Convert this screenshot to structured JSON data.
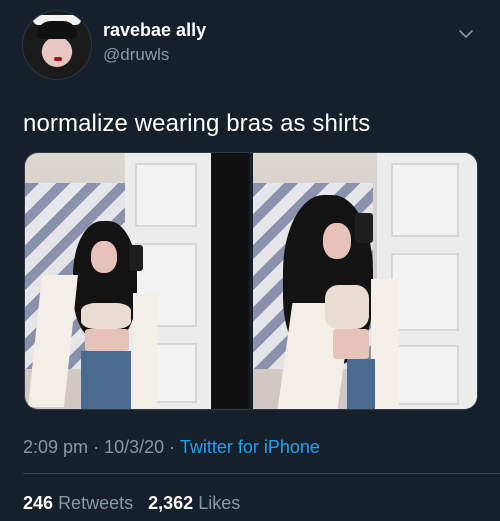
{
  "user": {
    "display_name": "ravebae ally",
    "handle": "@druwls",
    "avatar_icon": "avatar-icon"
  },
  "tweet": {
    "text": "normalize wearing bras as shirts",
    "time": "2:09 pm",
    "separator": "·",
    "date": "10/3/20",
    "source": "Twitter for iPhone"
  },
  "stats": {
    "retweets_count": "246",
    "retweets_label": "Retweets",
    "likes_count": "2,362",
    "likes_label": "Likes"
  },
  "colors": {
    "background": "#15202b",
    "secondary_text": "#8899a6",
    "link": "#1da1f2"
  }
}
